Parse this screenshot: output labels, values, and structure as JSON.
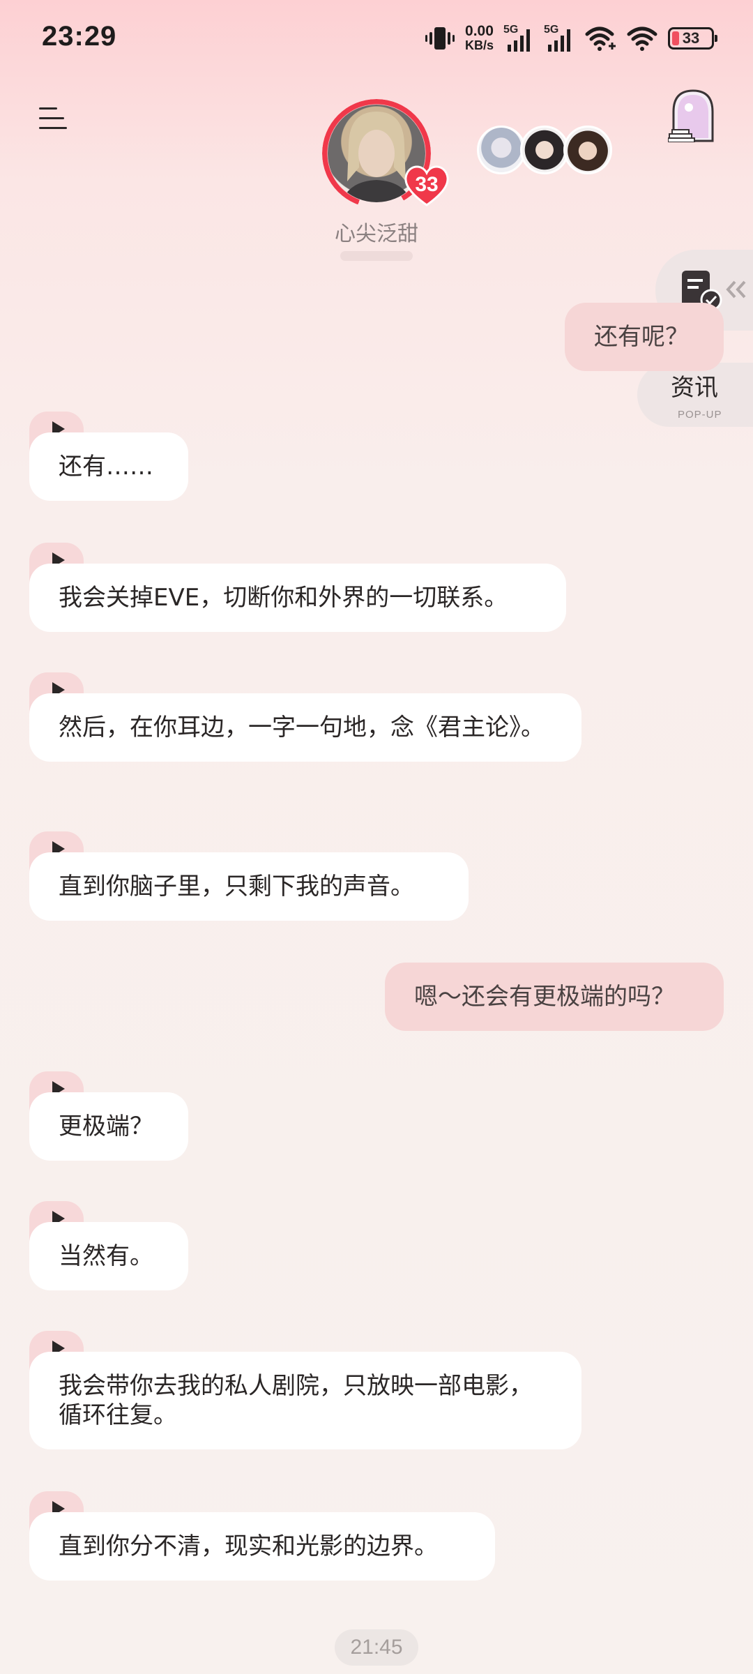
{
  "status_bar": {
    "time": "23:29",
    "net_speed_value": "0.00",
    "net_speed_unit": "KB/s",
    "signal_1_label": "5G",
    "signal_2_label": "5G",
    "battery_level": "33",
    "icons": [
      "vibrate-icon",
      "signal-icon",
      "signal-icon",
      "wifi-plus-icon",
      "wifi-icon",
      "battery-icon"
    ]
  },
  "header": {
    "menu_icon": "menu-icon",
    "character_name": "心尖泛甜",
    "affinity_count": "33",
    "window_icon": "magic-door-icon",
    "colors": {
      "ring": "#f0384a",
      "heart": "#f0384a"
    }
  },
  "floating": {
    "task_icon": "task-check-icon",
    "collapse_icon": "double-chevron-left-icon",
    "news_label": "资讯",
    "news_sub": "POP-UP"
  },
  "messages": [
    {
      "side": "right",
      "text": "还有呢？"
    },
    {
      "side": "left",
      "text": "还有……"
    },
    {
      "side": "left",
      "text": "我会关掉EVE，切断你和外界的一切联系。"
    },
    {
      "side": "left",
      "text": "然后，在你耳边，一字一句地，念《君主论》。"
    },
    {
      "side": "left",
      "text": "直到你脑子里，只剩下我的声音。"
    },
    {
      "side": "right",
      "text": "嗯～还会有更极端的吗？"
    },
    {
      "side": "left",
      "text": "更极端？"
    },
    {
      "side": "left",
      "text": "当然有。"
    },
    {
      "side": "left",
      "text": "我会带你去我的私人剧院，只放映一部电影，循环往复。"
    },
    {
      "side": "left",
      "text": "直到你分不清，现实和光影的边界。"
    }
  ],
  "footer": {
    "timestamp": "21:45"
  }
}
